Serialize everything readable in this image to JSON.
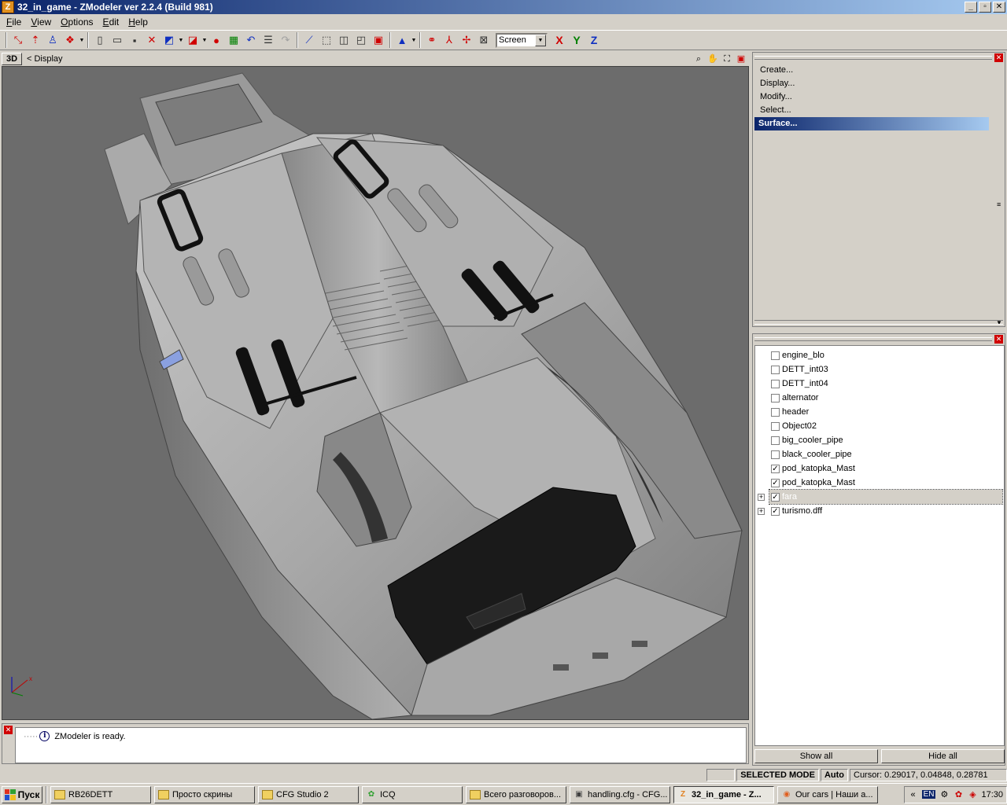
{
  "window": {
    "title": "32_in_game - ZModeler ver 2.2.4 (Build 981)",
    "app_icon": "Z",
    "minimize": "_",
    "maximize": "▫",
    "close": "✕"
  },
  "menu": [
    {
      "label_u": "F",
      "label_rest": "ile"
    },
    {
      "label_u": "V",
      "label_rest": "iew"
    },
    {
      "label_u": "O",
      "label_rest": "ptions"
    },
    {
      "label_u": "E",
      "label_rest": "dit"
    },
    {
      "label_u": "H",
      "label_rest": "elp"
    }
  ],
  "toolbar": {
    "screen_select": "Screen",
    "axis_x": "X",
    "axis_y": "Y",
    "axis_z": "Z"
  },
  "viewport": {
    "mode": "3D",
    "name": "<  Display"
  },
  "command_panel": {
    "items": [
      {
        "label": "Create..."
      },
      {
        "label": "Display..."
      },
      {
        "label": "Modify..."
      },
      {
        "label": "Select..."
      },
      {
        "label": "Surface...",
        "active": true
      }
    ]
  },
  "object_tree": {
    "items": [
      {
        "label": "engine_blo",
        "checked": false,
        "expandable": false
      },
      {
        "label": "DETT_int03",
        "checked": false,
        "expandable": false
      },
      {
        "label": "DETT_int04",
        "checked": false,
        "expandable": false
      },
      {
        "label": "alternator",
        "checked": false,
        "expandable": false
      },
      {
        "label": "header",
        "checked": false,
        "expandable": false
      },
      {
        "label": "Object02",
        "checked": false,
        "expandable": false
      },
      {
        "label": "big_cooler_pipe",
        "checked": false,
        "expandable": false
      },
      {
        "label": "black_cooler_pipe",
        "checked": false,
        "expandable": false
      },
      {
        "label": "pod_katopka_Mast",
        "checked": true,
        "expandable": false
      },
      {
        "label": "pod_katopka_Mast",
        "checked": true,
        "expandable": false
      },
      {
        "label": "fara",
        "checked": true,
        "expandable": true,
        "selected": true
      },
      {
        "label": "turismo.dff",
        "checked": true,
        "expandable": true
      }
    ],
    "show_all": "Show all",
    "hide_all": "Hide all"
  },
  "log": {
    "message": "ZModeler is ready."
  },
  "status": {
    "mode": "SELECTED MODE",
    "auto": "Auto",
    "cursor": "Cursor: 0.29017, 0.04848, 0.28781"
  },
  "taskbar": {
    "start": "Пуск",
    "tasks": [
      {
        "label": "RB26DETT",
        "icon": "folder-icon"
      },
      {
        "label": "Просто скрины",
        "icon": "folder-icon"
      },
      {
        "label": "CFG Studio 2",
        "icon": "folder-icon"
      },
      {
        "label": "ICQ",
        "icon": "icq-icon"
      },
      {
        "label": "Всего разговоров...",
        "icon": "folder-icon"
      },
      {
        "label": "handling.cfg - CFG...",
        "icon": "cfg-icon"
      },
      {
        "label": "32_in_game - Z...",
        "icon": "zmodeler-icon",
        "active": true
      },
      {
        "label": "Our cars | Наши а...",
        "icon": "firefox-icon"
      }
    ],
    "lang": "EN",
    "clock": "17:30"
  }
}
